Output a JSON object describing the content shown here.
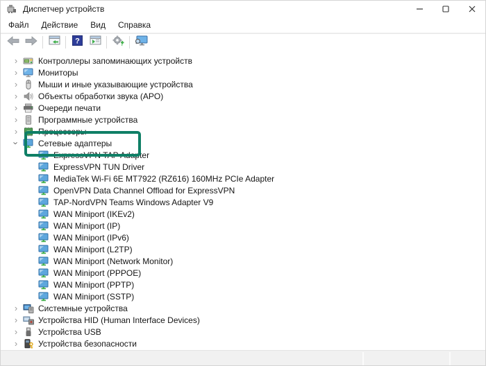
{
  "window": {
    "title": "Диспетчер устройств",
    "controls": {
      "minimize": "–",
      "maximize": "",
      "close": ""
    }
  },
  "menu": {
    "items": [
      "Файл",
      "Действие",
      "Вид",
      "Справка"
    ]
  },
  "toolbar": {
    "buttons": [
      {
        "name": "back-button",
        "icon": "back-arrow-icon"
      },
      {
        "name": "forward-button",
        "icon": "forward-arrow-icon"
      },
      {
        "separator": true
      },
      {
        "name": "show-console-tree-button",
        "icon": "console-window-icon"
      },
      {
        "separator": true
      },
      {
        "name": "help-button",
        "icon": "help-icon"
      },
      {
        "name": "action-pane-button",
        "icon": "action-window-icon"
      },
      {
        "separator": true
      },
      {
        "name": "add-device-button",
        "icon": "gear-plus-icon"
      },
      {
        "separator": true
      },
      {
        "name": "scan-hardware-changes-button",
        "icon": "monitor-search-icon"
      }
    ]
  },
  "tree": {
    "items": [
      {
        "label": "Контроллеры запоминающих устройств",
        "level": 0,
        "state": "collapsed",
        "icon": "storage-controller-icon"
      },
      {
        "label": "Мониторы",
        "level": 0,
        "state": "collapsed",
        "icon": "monitor-icon"
      },
      {
        "label": "Мыши и иные указывающие устройства",
        "level": 0,
        "state": "collapsed",
        "icon": "mouse-icon"
      },
      {
        "label": "Объекты обработки звука (APO)",
        "level": 0,
        "state": "collapsed",
        "icon": "audio-apo-icon"
      },
      {
        "label": "Очереди печати",
        "level": 0,
        "state": "collapsed",
        "icon": "printer-icon"
      },
      {
        "label": "Программные устройства",
        "level": 0,
        "state": "collapsed",
        "icon": "software-device-icon"
      },
      {
        "label": "Процессоры",
        "level": 0,
        "state": "collapsed",
        "icon": "processor-icon"
      },
      {
        "label": "Сетевые адаптеры",
        "level": 0,
        "state": "expanded",
        "icon": "network-adapter-icon",
        "highlighted": true
      },
      {
        "label": "ExpressVPN TAP Adapter",
        "level": 1,
        "state": "none",
        "icon": "network-adapter-icon"
      },
      {
        "label": "ExpressVPN TUN Driver",
        "level": 1,
        "state": "none",
        "icon": "network-adapter-icon"
      },
      {
        "label": "MediaTek Wi-Fi 6E MT7922 (RZ616) 160MHz PCIe Adapter",
        "level": 1,
        "state": "none",
        "icon": "network-adapter-icon"
      },
      {
        "label": "OpenVPN Data Channel Offload for ExpressVPN",
        "level": 1,
        "state": "none",
        "icon": "network-adapter-icon"
      },
      {
        "label": "TAP-NordVPN Teams Windows Adapter V9",
        "level": 1,
        "state": "none",
        "icon": "network-adapter-icon"
      },
      {
        "label": "WAN Miniport (IKEv2)",
        "level": 1,
        "state": "none",
        "icon": "network-adapter-icon"
      },
      {
        "label": "WAN Miniport (IP)",
        "level": 1,
        "state": "none",
        "icon": "network-adapter-icon"
      },
      {
        "label": "WAN Miniport (IPv6)",
        "level": 1,
        "state": "none",
        "icon": "network-adapter-icon"
      },
      {
        "label": "WAN Miniport (L2TP)",
        "level": 1,
        "state": "none",
        "icon": "network-adapter-icon"
      },
      {
        "label": "WAN Miniport (Network Monitor)",
        "level": 1,
        "state": "none",
        "icon": "network-adapter-icon"
      },
      {
        "label": "WAN Miniport (PPPOE)",
        "level": 1,
        "state": "none",
        "icon": "network-adapter-icon"
      },
      {
        "label": "WAN Miniport (PPTP)",
        "level": 1,
        "state": "none",
        "icon": "network-adapter-icon"
      },
      {
        "label": "WAN Miniport (SSTP)",
        "level": 1,
        "state": "none",
        "icon": "network-adapter-icon"
      },
      {
        "label": "Системные устройства",
        "level": 0,
        "state": "collapsed",
        "icon": "system-device-icon"
      },
      {
        "label": "Устройства HID (Human Interface Devices)",
        "level": 0,
        "state": "collapsed",
        "icon": "hid-device-icon"
      },
      {
        "label": "Устройства USB",
        "level": 0,
        "state": "collapsed",
        "icon": "usb-device-icon"
      },
      {
        "label": "Устройства безопасности",
        "level": 0,
        "state": "collapsed",
        "icon": "security-device-icon"
      }
    ]
  },
  "annotation": {
    "type": "highlight-rectangle",
    "target": "Сетевые адаптеры",
    "color": "#0f7f66"
  }
}
